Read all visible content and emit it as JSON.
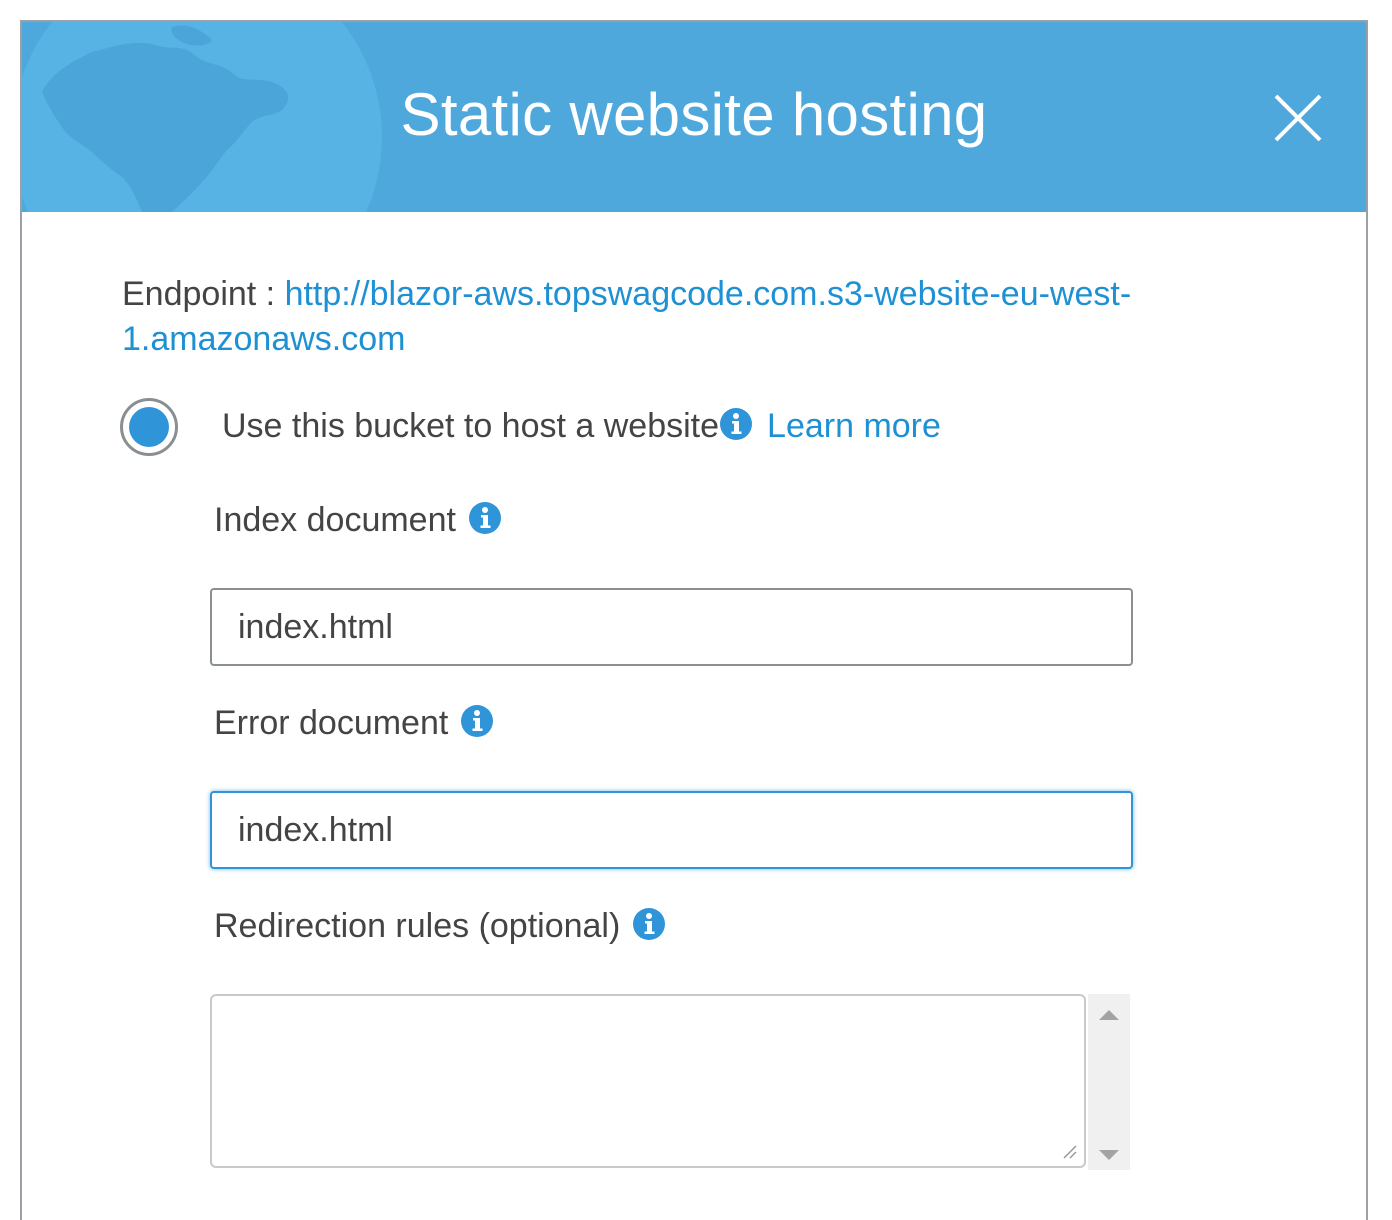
{
  "dialog": {
    "title": "Static website hosting"
  },
  "endpoint": {
    "label": "Endpoint :",
    "url_line1": "http://blazor-aws.topswagcode.com.s3-website-eu-west-",
    "url_line2": "1.amazonaws.com"
  },
  "hosting_option": {
    "label": "Use this bucket to host a website",
    "learn_more": "Learn more",
    "selected": true
  },
  "index_document": {
    "label": "Index document",
    "value": "index.html"
  },
  "error_document": {
    "label": "Error document",
    "value": "index.html"
  },
  "redirection_rules": {
    "label": "Redirection rules (optional)",
    "value": ""
  },
  "colors": {
    "header_bg": "#4ea8dc",
    "accent": "#2f95d8",
    "link": "#1e90d4",
    "text": "#444444"
  },
  "icons": [
    "close-icon",
    "info-icon",
    "globe-icon",
    "scroll-up-icon",
    "scroll-down-icon",
    "resize-grip-icon"
  ]
}
